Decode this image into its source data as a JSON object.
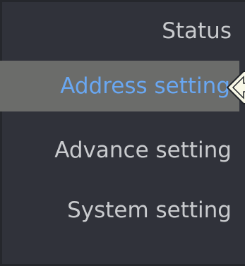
{
  "menu": {
    "items": [
      {
        "label": "Status"
      },
      {
        "label": "Address setting"
      },
      {
        "label": "Advance setting"
      },
      {
        "label": "System setting"
      }
    ],
    "active_index": 1
  },
  "colors": {
    "background": "#30323a",
    "active_background": "#6b6c6a",
    "text": "#c9cbce",
    "active_text": "#69a7f2",
    "indicator_fill": "#f7f7e6"
  },
  "icons": {
    "active_indicator": "left-arrow-icon"
  }
}
